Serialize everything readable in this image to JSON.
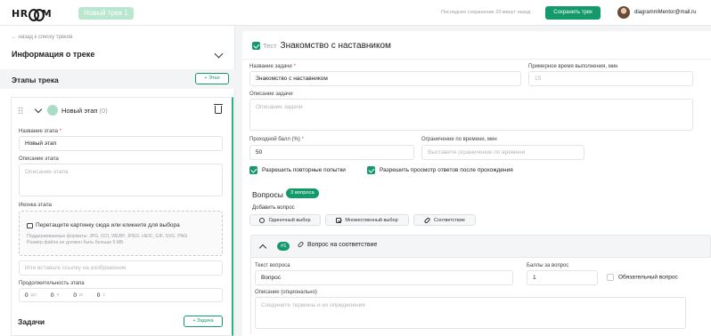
{
  "header": {
    "logo": "HROOM",
    "track_badge": "Новый трек 1",
    "last_save": "Последнее сохранение 20 минут назад",
    "save_button": "Сохранить трек",
    "user_email": "diagrammMentor@mail.ru"
  },
  "sidebar": {
    "back_link": "←  назад к списку треков",
    "info_title": "Информация о треке",
    "stages_title": "Этапы трека",
    "add_stage": "+ Этап",
    "stage": {
      "name": "Новый этап",
      "count": "(0)",
      "name_label": "Название этапа",
      "name_value": "Новый этап",
      "desc_label": "Описание этапа",
      "desc_placeholder": "Описание этапа",
      "icon_label": "Иконка этапа",
      "upload_main": "Перетащите картинку сюда или кликните для выбора",
      "upload_formats": "Поддерживаемые форматы: JPG, ICO, WEBP, JPEG, HEIC, GIF, SVG, PNG",
      "upload_size": "Размер файла не должен быть больше 5 МБ",
      "url_placeholder": "Или вставьте ссылку на изображение",
      "duration_label": "Продолжительность этапа",
      "duration": [
        {
          "value": "0",
          "unit": "дн"
        },
        {
          "value": "0",
          "unit": "ч"
        },
        {
          "value": "0",
          "unit": "м"
        },
        {
          "value": "0",
          "unit": "с"
        }
      ]
    },
    "tasks_title": "Задачи",
    "add_task": "+ Задача"
  },
  "task": {
    "type": "Тест",
    "title": "Знакомство с наставником",
    "name_label": "Название задачи",
    "name_value": "Знакомство с наставником",
    "time_label": "Примерное время выполнения, мин",
    "time_value": "15",
    "desc_label": "Описание задачи",
    "desc_placeholder": "Описание задачи",
    "score_label": "Проходной балл (%)",
    "score_value": "50",
    "limit_label": "Ограничение по времени, мин",
    "limit_placeholder": "Выставите ограничение по времени",
    "allow_retries": "Разрешить повторные попытки",
    "allow_view": "Разрешить просмотр ответов после прохождения",
    "questions_title": "Вопросы",
    "questions_count": "3 вопроса",
    "add_question": "Добавить вопрос",
    "question_types": [
      "Одиночный выбор",
      "Множественный выбор",
      "Соответствие"
    ],
    "question": {
      "number": "#1",
      "kind": "Вопрос на соответствие",
      "text_label": "Текст вопроса",
      "text_value": "Вопрос",
      "points_label": "Баллы за вопрос",
      "points_value": "1",
      "required_label": "Обязательный вопрос",
      "desc_label": "Описание (опционально)",
      "desc_placeholder": "Соедините термины и их определения"
    }
  },
  "colors": {
    "accent": "#149a6a",
    "badge": "#b8e6cf"
  }
}
